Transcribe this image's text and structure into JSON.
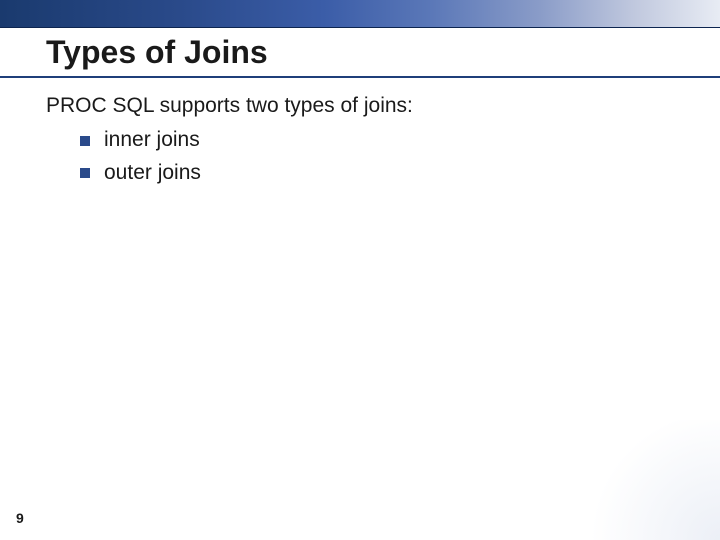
{
  "title": "Types of Joins",
  "intro": "PROC SQL supports two types of joins:",
  "bullets": [
    "inner joins",
    "outer joins"
  ],
  "page_number": "9",
  "colors": {
    "accent": "#2a4a8a",
    "underline": "#1f3f7a"
  }
}
